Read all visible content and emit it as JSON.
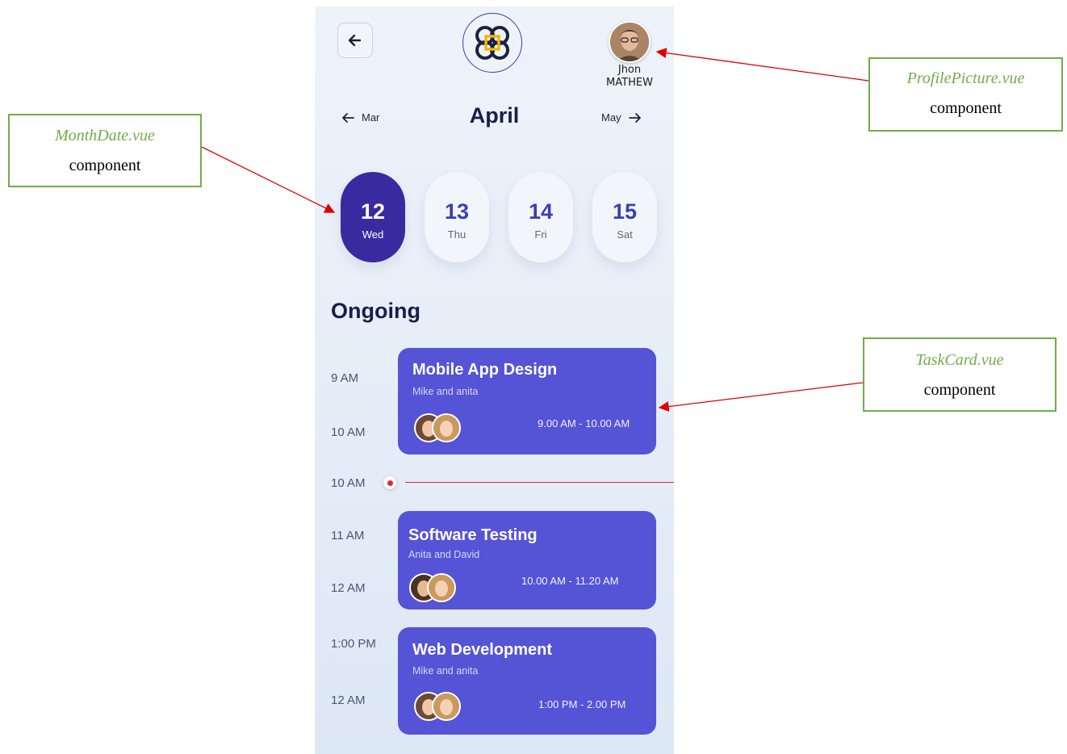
{
  "header": {
    "back_icon": "arrow-left-icon",
    "logo_icon": "app-logo",
    "profile": {
      "name_first": "Jhon",
      "name_last": "MATHEW"
    }
  },
  "month_nav": {
    "prev": "Mar",
    "current": "April",
    "next": "May"
  },
  "days": [
    {
      "num": "12",
      "weekday": "Wed",
      "active": true
    },
    {
      "num": "13",
      "weekday": "Thu",
      "active": false
    },
    {
      "num": "14",
      "weekday": "Fri",
      "active": false
    },
    {
      "num": "15",
      "weekday": "Sat",
      "active": false
    }
  ],
  "section_title": "Ongoing",
  "times": [
    "9 AM",
    "10 AM",
    "10 AM",
    "11 AM",
    "12 AM",
    "1:00 PM",
    "12 AM"
  ],
  "tasks": [
    {
      "title": "Mobile App Design",
      "people": "Mike and anita",
      "time": "9.00 AM - 10.00 AM"
    },
    {
      "title": "Software Testing",
      "people": "Anita and David",
      "time": "10.00 AM - 11.20 AM"
    },
    {
      "title": "Web Development",
      "people": "Mike and anita",
      "time": "1:00 PM - 2.00 PM"
    }
  ],
  "annotations": {
    "month_date": {
      "file": "MonthDate.vue",
      "label": "component"
    },
    "profile_picture": {
      "file": "ProfilePicture.vue",
      "label": "component"
    },
    "task_card": {
      "file": "TaskCard.vue",
      "label": "component"
    }
  },
  "colors": {
    "accent": "#5553d6",
    "active_day": "#3a2a9f",
    "annotation_green": "#70ad47",
    "arrow_red": "#e00000",
    "now_indicator": "#e0283a"
  }
}
